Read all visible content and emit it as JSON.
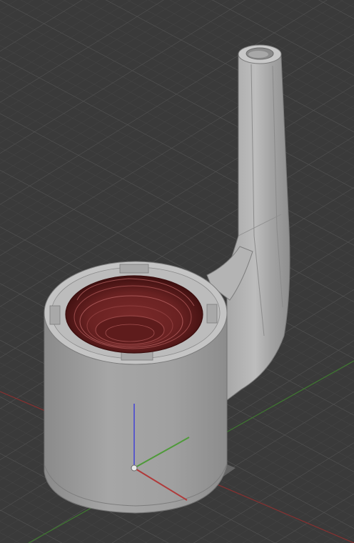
{
  "viewport": {
    "background_color": "#3a3a3a",
    "grid_minor_color": "#474747",
    "grid_major_color": "#545454",
    "x_axis_color": "#b03a3a",
    "y_axis_color": "#4f9a3a",
    "z_axis_color": "#5a5ac8",
    "grid_visible": true
  },
  "model": {
    "body_color": "#9c9c9c",
    "body_shadow_color": "#7e7e7e",
    "body_highlight_color": "#c2c2c2",
    "cavity_color": "#6e2626",
    "cavity_dark_color": "#3d0f0f",
    "edge_color": "#6a6a6a",
    "parts": [
      "cup-body",
      "cup-cavity",
      "spout-tube"
    ]
  },
  "gizmo": {
    "icons": [
      "x-axis-icon",
      "y-axis-icon",
      "z-axis-icon",
      "origin-icon"
    ]
  }
}
